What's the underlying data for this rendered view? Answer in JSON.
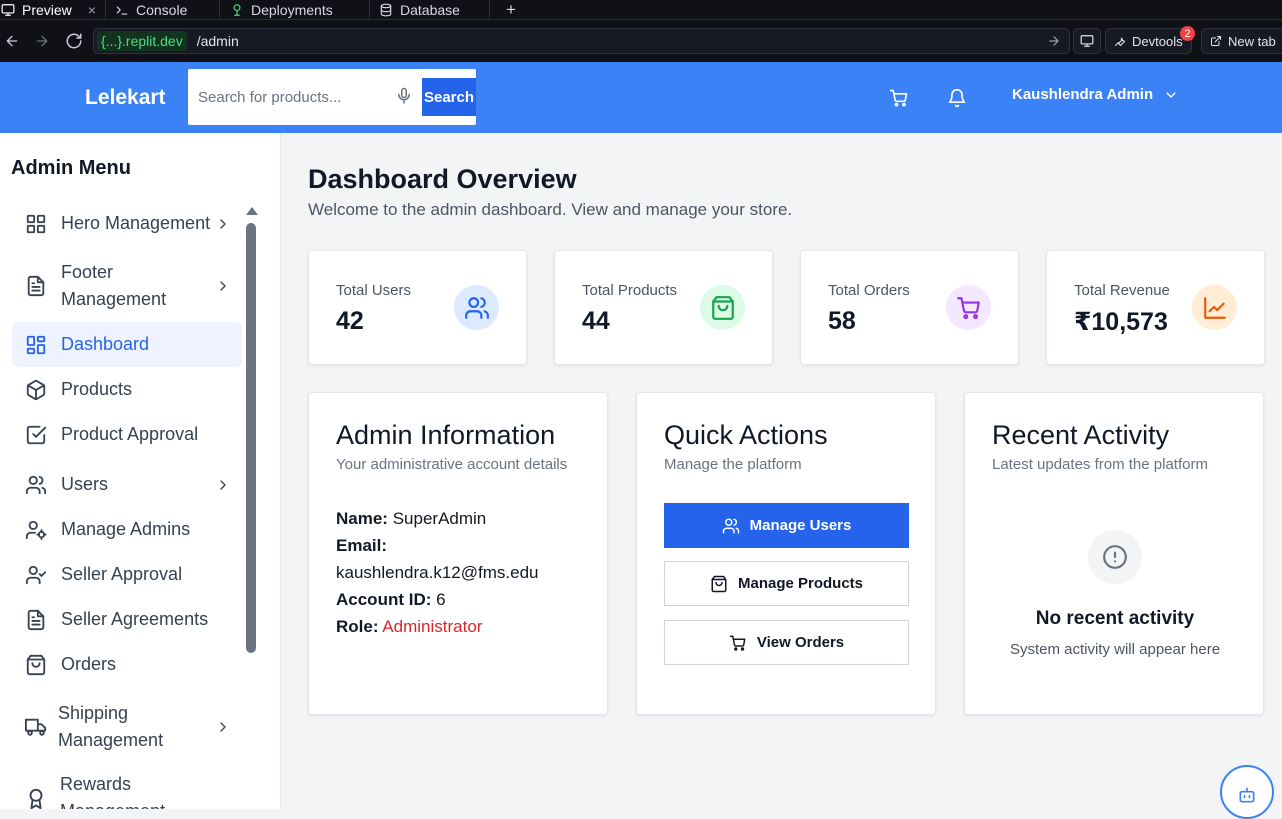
{
  "browser": {
    "tabs": [
      {
        "label": "Preview",
        "icon": "monitor-icon",
        "active": true
      },
      {
        "label": "Console",
        "icon": "terminal-icon"
      },
      {
        "label": "Deployments",
        "icon": "deploy-icon"
      },
      {
        "label": "Database",
        "icon": "database-icon"
      }
    ],
    "new_tab_symbol": "+",
    "close_symbol": "×",
    "url_domain": "{...}.replit.dev",
    "url_path": "/admin",
    "devtools_label": "Devtools",
    "devtools_badge": "2",
    "newtab_label": "New tab"
  },
  "header": {
    "brand": "Lelekart",
    "search_placeholder": "Search for products...",
    "search_button": "Search",
    "user_name": "Kaushlendra Admin",
    "colors": {
      "header_bg": "#3b82f6",
      "primary": "#2563eb"
    }
  },
  "sidebar": {
    "title": "Admin Menu",
    "items": [
      {
        "label": "Hero Management",
        "icon": "grid-icon",
        "chevron": true
      },
      {
        "label": "Footer Management",
        "icon": "file-text-icon",
        "chevron": true
      },
      {
        "label": "Dashboard",
        "icon": "layout-dashboard-icon",
        "active": true
      },
      {
        "label": "Products",
        "icon": "package-icon"
      },
      {
        "label": "Product Approval",
        "icon": "check-square-icon"
      },
      {
        "label": "Users",
        "icon": "users-icon",
        "chevron": true
      },
      {
        "label": "Manage Admins",
        "icon": "user-cog-icon"
      },
      {
        "label": "Seller Approval",
        "icon": "user-check-icon"
      },
      {
        "label": "Seller Agreements",
        "icon": "file-text-icon"
      },
      {
        "label": "Orders",
        "icon": "shopping-bag-icon"
      },
      {
        "label": "Shipping Management",
        "icon": "truck-icon",
        "chevron": true
      },
      {
        "label": "Rewards Management",
        "icon": "award-icon"
      }
    ]
  },
  "dashboard": {
    "title": "Dashboard Overview",
    "subtitle": "Welcome to the admin dashboard. View and manage your store.",
    "stats": [
      {
        "label": "Total Users",
        "value": "42",
        "icon": "users-icon",
        "color": "#2563eb",
        "bg": "#dbeafe"
      },
      {
        "label": "Total Products",
        "value": "44",
        "icon": "shopping-bag-icon",
        "color": "#16a34a",
        "bg": "#dcfce7"
      },
      {
        "label": "Total Orders",
        "value": "58",
        "icon": "shopping-cart-icon",
        "color": "#9333ea",
        "bg": "#f3e8ff"
      },
      {
        "label": "Total Revenue",
        "value": "₹10,573",
        "icon": "trending-up-icon",
        "color": "#ea580c",
        "bg": "#ffedd5"
      }
    ]
  },
  "admin_info": {
    "title": "Admin Information",
    "subtitle": "Your administrative account details",
    "name_label": "Name:",
    "name_value": "SuperAdmin",
    "email_label": "Email:",
    "email_value": "kaushlendra.k12@fms.edu",
    "account_label": "Account ID:",
    "account_value": "6",
    "role_label": "Role:",
    "role_value": "Administrator",
    "role_color": "#dc2626"
  },
  "quick_actions": {
    "title": "Quick Actions",
    "subtitle": "Manage the platform",
    "buttons": [
      {
        "label": "Manage Users",
        "icon": "users-icon"
      },
      {
        "label": "Manage Products",
        "icon": "shopping-bag-icon"
      },
      {
        "label": "View Orders",
        "icon": "shopping-cart-icon"
      }
    ]
  },
  "recent_activity": {
    "title": "Recent Activity",
    "subtitle": "Latest updates from the platform",
    "empty_title": "No recent activity",
    "empty_subtitle": "System activity will appear here",
    "empty_icon": "alert-circle-icon"
  },
  "floating": {
    "icon": "bot-icon"
  }
}
